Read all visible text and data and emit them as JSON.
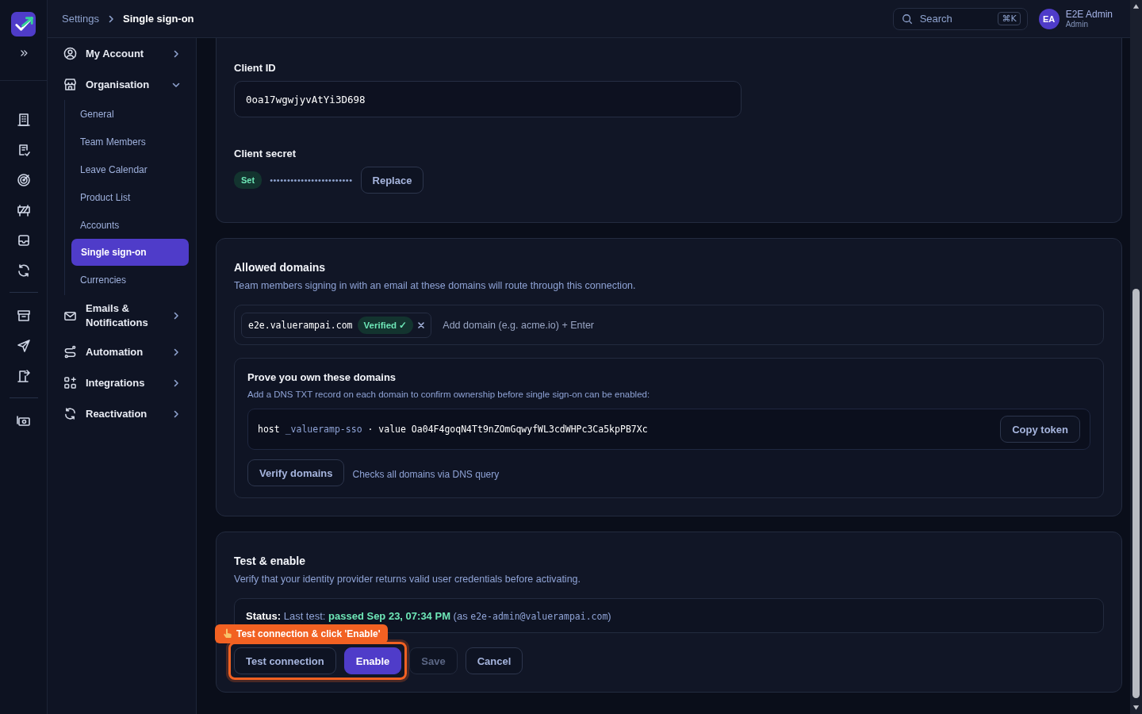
{
  "breadcrumb": [
    {
      "label": "Settings",
      "current": false
    },
    {
      "label": "Single sign-on",
      "current": true
    }
  ],
  "search": {
    "placeholder": "Search",
    "shortcut": "⌘K"
  },
  "user": {
    "initials": "EA",
    "name": "E2E Admin",
    "role": "Admin"
  },
  "settings_nav": [
    {
      "label": "My Account",
      "expanded": false
    },
    {
      "label": "Organisation",
      "expanded": true,
      "children": [
        {
          "label": "General",
          "selected": false
        },
        {
          "label": "Team Members",
          "selected": false
        },
        {
          "label": "Leave Calendar",
          "selected": false
        },
        {
          "label": "Product List",
          "selected": false
        },
        {
          "label": "Accounts",
          "selected": false
        },
        {
          "label": "Single sign-on",
          "selected": true
        },
        {
          "label": "Currencies",
          "selected": false
        }
      ]
    },
    {
      "label": "Emails & Notifications",
      "expanded": false
    },
    {
      "label": "Automation",
      "expanded": false
    },
    {
      "label": "Integrations",
      "expanded": false
    },
    {
      "label": "Reactivation",
      "expanded": false
    }
  ],
  "credentials": {
    "client_id": {
      "label": "Client ID",
      "value": "0oa17wgwjyvAtYi3D698"
    },
    "client_secret": {
      "label": "Client secret",
      "badge": "Set",
      "masked": "••••••••••••••••••••••••",
      "button": "Replace"
    }
  },
  "allowed_domains": {
    "title": "Allowed domains",
    "description": "Team members signing in with an email at these domains will route through this connection.",
    "domains": [
      {
        "name": "e2e.valuerampai.com",
        "status": "Verified ✓",
        "verified": true
      }
    ],
    "placeholder": "Add domain (e.g. acme.io) + Enter",
    "proof": {
      "title": "Prove you own these domains",
      "description": "Add a DNS TXT record on each domain to confirm ownership before single sign-on can be enabled:",
      "record": {
        "host_label": "host",
        "host": "_valueramp-sso",
        "separator": "·",
        "value_label": "value",
        "value": "Oa04F4goqN4Tt9nZOmGqwyfWL3cdWHPc3Ca5kpPB7Xc"
      },
      "copy_button": "Copy token",
      "verify_button": "Verify domains",
      "hint": "Checks all domains via DNS query"
    }
  },
  "test_enable": {
    "title": "Test & enable",
    "description": "Verify that your identity provider returns valid user credentials before activating.",
    "status": {
      "label": "Status:",
      "prefix": "Last test:",
      "result": "passed Sep 23, 07:34 PM",
      "open": "(as",
      "email": "e2e-admin@valuerampai.com",
      "close": ")"
    },
    "buttons": [
      {
        "label": "Test connection",
        "kind": "secondary",
        "disabled": false,
        "highlighted": true
      },
      {
        "label": "Enable",
        "kind": "primary",
        "disabled": false,
        "highlighted": true
      },
      {
        "label": "Save",
        "kind": "secondary",
        "disabled": true,
        "highlighted": false
      },
      {
        "label": "Cancel",
        "kind": "secondary",
        "disabled": false,
        "highlighted": false
      }
    ],
    "callout": {
      "text": "Test connection & click 'Enable'"
    }
  }
}
